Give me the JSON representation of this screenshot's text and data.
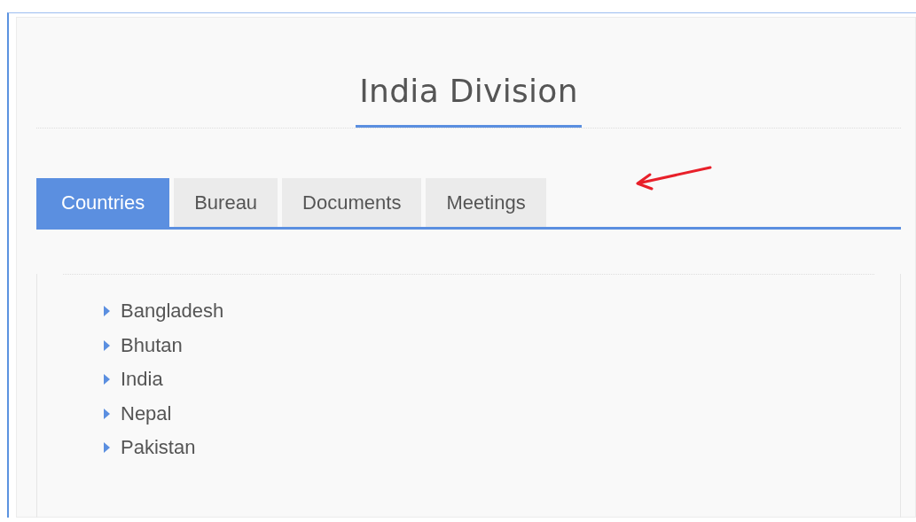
{
  "title": "India Division",
  "tabs": [
    {
      "label": "Countries",
      "selected": true
    },
    {
      "label": "Bureau",
      "selected": false
    },
    {
      "label": "Documents",
      "selected": false
    },
    {
      "label": "Meetings",
      "selected": false
    }
  ],
  "countries": [
    "Bangladesh",
    "Bhutan",
    "India",
    "Nepal",
    "Pakistan"
  ]
}
